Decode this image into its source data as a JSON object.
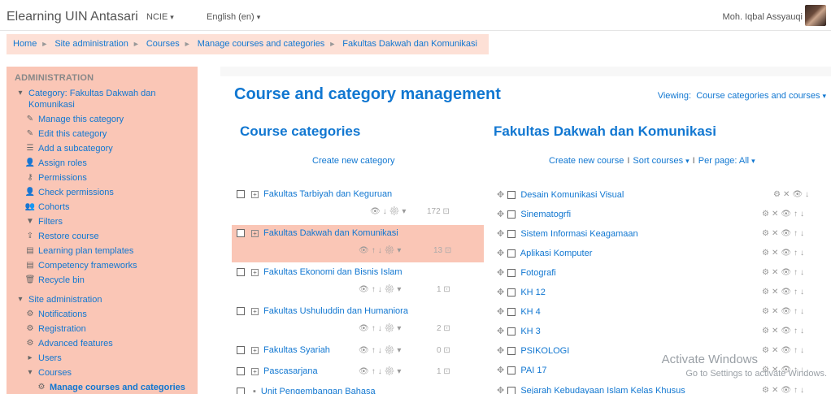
{
  "navbar": {
    "brand": "Elearning UIN Antasari",
    "menu_ncie": "NCIE",
    "menu_lang": "English (en)",
    "username": "Moh. Iqbal Assyauqi"
  },
  "breadcrumb": [
    "Home",
    "Site administration",
    "Courses",
    "Manage courses and categories",
    "Fakultas Dakwah dan Komunikasi"
  ],
  "admin": {
    "title": "ADMINISTRATION",
    "category_line1": "Category: Fakultas Dakwah dan",
    "category_line2": "Komunikasi",
    "cat_items": [
      "Manage this category",
      "Edit this category",
      "Add a subcategory",
      "Assign roles",
      "Permissions",
      "Check permissions",
      "Cohorts",
      "Filters",
      "Restore course",
      "Learning plan templates",
      "Competency frameworks",
      "Recycle bin"
    ],
    "site_admin": "Site administration",
    "site_items": [
      "Notifications",
      "Registration",
      "Advanced features"
    ],
    "users": "Users",
    "courses": "Courses",
    "current": "Manage courses and categories"
  },
  "main": {
    "title": "Course and category management",
    "viewing_label": "Viewing:",
    "viewing_value": "Course categories and courses",
    "categories_heading": "Course categories",
    "create_category": "Create new category",
    "courses_heading": "Fakultas Dakwah dan Komunikasi",
    "create_course": "Create new course",
    "sort_courses": "Sort courses",
    "per_page": "Per page: All"
  },
  "categories": [
    {
      "name": "Fakultas Tarbiyah dan Keguruan",
      "count": "172"
    },
    {
      "name": "Fakultas Dakwah dan Komunikasi",
      "count": "13"
    },
    {
      "name": "Fakultas Ekonomi dan Bisnis Islam",
      "count": "1"
    },
    {
      "name": "Fakultas Ushuluddin dan Humaniora",
      "count": "2"
    },
    {
      "name": "Fakultas Syariah",
      "count": "0"
    },
    {
      "name": "Pascasarjana",
      "count": "1"
    },
    {
      "name": "Unit Pengembangan Bahasa",
      "count": ""
    }
  ],
  "courses": [
    "Desain Komunikasi Visual",
    "Sinematogrfi",
    "Sistem Informasi Keagamaan",
    "Aplikasi Komputer",
    "Fotografi",
    "KH 12",
    "KH 4",
    "KH 3",
    "PSIKOLOGI",
    "PAI 17",
    "Sejarah Kebudayaan Islam Kelas Khusus"
  ],
  "watermark": {
    "line1": "Activate Windows",
    "line2": "Go to Settings to activate Windows."
  },
  "colors": {
    "accent": "#1177d1",
    "highlight": "#fac6b6",
    "breadcrumb_bg": "#fde0d6"
  }
}
